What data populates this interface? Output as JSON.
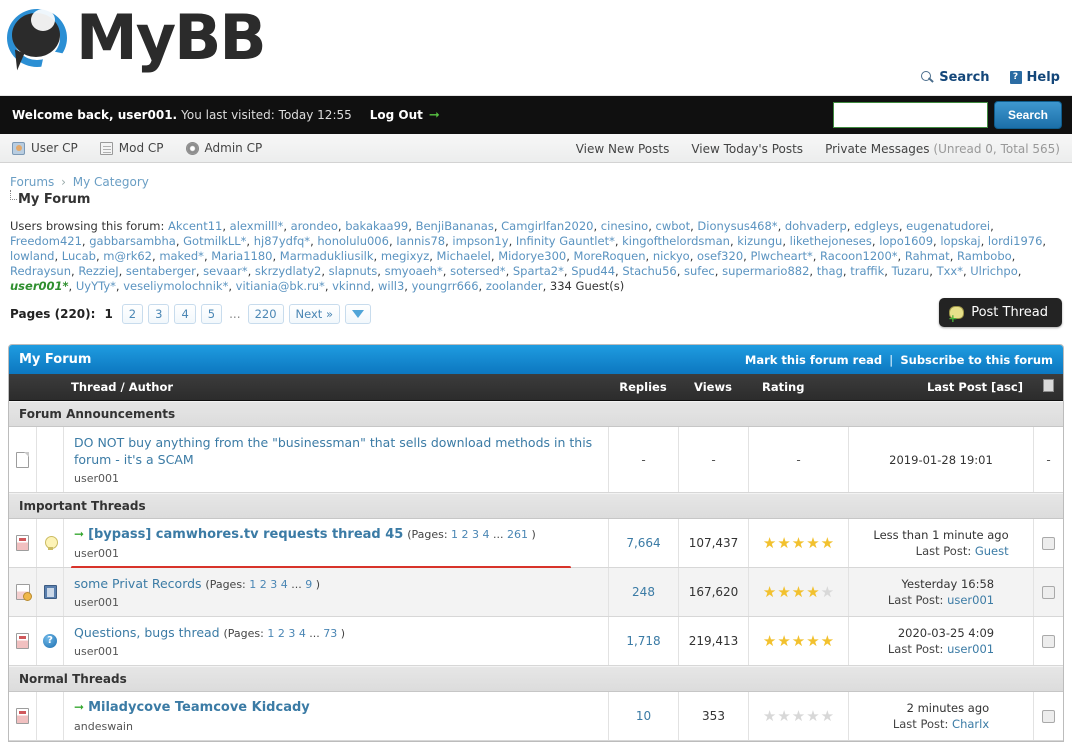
{
  "brand": {
    "name": "MyBB"
  },
  "top_links": [
    {
      "label": "Search",
      "icon": "search-icon"
    },
    {
      "label": "Help",
      "icon": "help-icon"
    }
  ],
  "welcome": {
    "greeting": "Welcome back, user001.",
    "last_visited": "You last visited: Today 12:55",
    "logout_label": "Log Out",
    "search_value": "",
    "search_placeholder": "",
    "search_button": "Search"
  },
  "cp_nav": {
    "items": [
      {
        "label": "User CP",
        "icon": "user-cp-icon"
      },
      {
        "label": "Mod CP",
        "icon": "mod-cp-icon"
      },
      {
        "label": "Admin CP",
        "icon": "admin-cp-icon"
      }
    ],
    "right": [
      {
        "label": "View New Posts"
      },
      {
        "label": "View Today's Posts"
      },
      {
        "label": "Private Messages",
        "meta": "(Unread 0, Total 565)"
      }
    ]
  },
  "breadcrumb": {
    "items": [
      "Forums",
      "My Category"
    ],
    "separator": "›",
    "current": "My Forum"
  },
  "browsing": {
    "prefix": "Users browsing this forum:",
    "users": [
      "Akcent11",
      "alexmilll*",
      "arondeo",
      "bakakaa99",
      "BenjiBananas",
      "Camgirlfan2020",
      "cinesino",
      "cwbot",
      "Dionysus468*",
      "dohvaderp",
      "edgleys",
      "eugenatudorei",
      "Freedom421",
      "gabbarsambha",
      "GotmilkLL*",
      "hj87ydfq*",
      "honolulu006",
      "Iannis78",
      "impson1y",
      "Infinity Gauntlet*",
      "kingofthelordsman",
      "kizungu",
      "likethejoneses",
      "lopo1609",
      "lopskaj",
      "lordi1976",
      "lowland",
      "Lucab",
      "m@rk62",
      "maked*",
      "Maria1180",
      "Marmadukliusilk",
      "megixyz",
      "Michaelel",
      "Midorye300",
      "MoreRoquen",
      "nickyo",
      "osef320",
      "Plwcheart*",
      "Racoon1200*",
      "Rahmat",
      "Rambobo",
      "Redraysun",
      "RezzieJ",
      "sentaberger",
      "sevaar*",
      "skrzydlaty2",
      "slapnuts",
      "smyoaeh*",
      "sotersed*",
      "Sparta2*",
      "Spud44",
      "Stachu56",
      "sufec",
      "supermario882",
      "thag",
      "traffik",
      "Tuzaru",
      "Txx*",
      "Ulrichpo"
    ],
    "self_user": "user001*",
    "users_after": [
      "UyYTy*",
      "veseliymolochnik*",
      "vitiania@bk.ru*",
      "vkinnd",
      "will3",
      "youngrr666",
      "zoolander"
    ],
    "guests": "334 Guest(s)"
  },
  "pagination": {
    "label": "Pages (220):",
    "current": "1",
    "pages": [
      "2",
      "3",
      "4",
      "5"
    ],
    "ellipsis": "...",
    "last": "220",
    "next": "Next »",
    "jump_icon": "chevron-down-icon"
  },
  "post_thread_button": "Post Thread",
  "forum_table": {
    "title": "My Forum",
    "mark_read": "Mark this forum read",
    "subscribe": "Subscribe to this forum",
    "separator": "|",
    "headers": {
      "thread_author": "Thread / Author",
      "replies": "Replies",
      "views": "Views",
      "rating": "Rating",
      "last_post": "Last Post [asc]"
    },
    "groups": [
      {
        "name": "Forum Announcements",
        "rows": [
          {
            "status_icon": "document-icon",
            "prefix_icon": "",
            "go_arrow": false,
            "title": "DO NOT buy anything from the \"businessman\" that sells download methods in this forum - it's a SCAM",
            "bold": false,
            "pages": null,
            "author": "user001",
            "replies": "-",
            "views": "-",
            "rating": null,
            "rating_dash": "-",
            "last_when": "2019-01-28 19:01",
            "last_who_label": "",
            "last_who": "",
            "checkbox": "dash",
            "alt": false,
            "underline": false
          }
        ]
      },
      {
        "name": "Important Threads",
        "rows": [
          {
            "status_icon": "hot-thread-icon",
            "prefix_icon": "lightbulb-icon",
            "go_arrow": true,
            "title": "[bypass] camwhores.tv requests thread 45",
            "bold": true,
            "pages": {
              "label": "(Pages:",
              "nums": [
                "1",
                "2",
                "3",
                "4"
              ],
              "ellipsis": "...",
              "last": "261",
              "close": ")"
            },
            "author": "user001",
            "replies": "7,664",
            "views": "107,437",
            "rating": 5,
            "last_when": "Less than 1 minute ago",
            "last_who_label": "Last Post:",
            "last_who": "Guest",
            "checkbox": "box",
            "alt": false,
            "underline": true
          },
          {
            "status_icon": "hot-thread-dot-icon",
            "prefix_icon": "film-icon",
            "go_arrow": false,
            "title": "some Privat Records",
            "bold": false,
            "pages": {
              "label": "(Pages:",
              "nums": [
                "1",
                "2",
                "3",
                "4"
              ],
              "ellipsis": "...",
              "last": "9",
              "close": ")"
            },
            "author": "user001",
            "replies": "248",
            "views": "167,620",
            "rating": 4,
            "last_when": "Yesterday 16:58",
            "last_who_label": "Last Post:",
            "last_who": "user001",
            "checkbox": "box",
            "alt": true,
            "underline": false
          },
          {
            "status_icon": "hot-thread-icon",
            "prefix_icon": "question-icon",
            "go_arrow": false,
            "title": "Questions, bugs thread",
            "bold": false,
            "pages": {
              "label": "(Pages:",
              "nums": [
                "1",
                "2",
                "3",
                "4"
              ],
              "ellipsis": "...",
              "last": "73",
              "close": ")"
            },
            "author": "user001",
            "replies": "1,718",
            "views": "219,413",
            "rating": 5,
            "last_when": "2020-03-25 4:09",
            "last_who_label": "Last Post:",
            "last_who": "user001",
            "checkbox": "box",
            "alt": false,
            "underline": false
          }
        ]
      },
      {
        "name": "Normal Threads",
        "rows": [
          {
            "status_icon": "hot-thread-icon",
            "prefix_icon": "",
            "go_arrow": true,
            "title": "Miladycove Teamcove Kidcady",
            "bold": true,
            "pages": null,
            "author": "andeswain",
            "replies": "10",
            "views": "353",
            "rating": 0,
            "last_when": "2 minutes ago",
            "last_who_label": "Last Post:",
            "last_who": "Charlx",
            "checkbox": "box",
            "alt": false,
            "underline": false
          }
        ]
      }
    ]
  },
  "colors": {
    "accent_blue": "#0c77c0",
    "link_blue": "#3b7ba5",
    "welcome_bar": "#101010",
    "star_gold": "#f2c12e",
    "underline_red": "#d8332a",
    "green_arrow": "#38a832"
  }
}
